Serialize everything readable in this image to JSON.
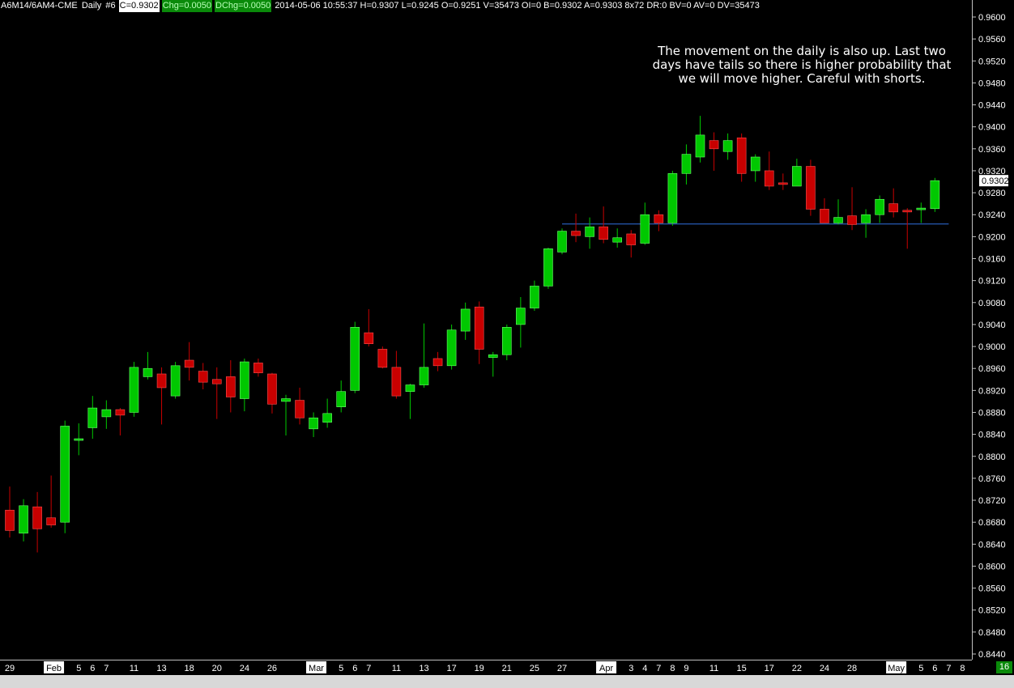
{
  "header": {
    "symbol": "A6M14/6AM4-CME",
    "interval": "Daily",
    "number": "#6",
    "close": "C=0.9302",
    "chg": "Chg=0.0050",
    "dchg": "DChg=0.0050",
    "details": "2014-05-06 10:55:37 H=0.9307 L=0.9245 O=0.9251 V=35473 OI=0 B=0.9302 A=0.9303 8x72 DR:0 BV=0 AV=0 DV=35473"
  },
  "annotation": "The movement on the daily is also up. Last two days have tails so there is higher probability that we will move higher. Careful with shorts.",
  "scroll_badge": "16",
  "colors": {
    "up": "#00c800",
    "down": "#c80000",
    "wick_up": "#00c800",
    "wick_down": "#c80000",
    "support": "#3070e0",
    "axis": "#c0c0c0"
  },
  "chart_data": {
    "type": "candlestick",
    "ylim": [
      0.8424,
      0.9624
    ],
    "y_ticks": [
      "0.9600",
      "0.9560",
      "0.9520",
      "0.9480",
      "0.9440",
      "0.9400",
      "0.9360",
      "0.9320",
      "0.9280",
      "0.9240",
      "0.9200",
      "0.9160",
      "0.9120",
      "0.9080",
      "0.9040",
      "0.9000",
      "0.8960",
      "0.8920",
      "0.8880",
      "0.8840",
      "0.8800",
      "0.8760",
      "0.8720",
      "0.8680",
      "0.8640",
      "0.8600",
      "0.8560",
      "0.8520",
      "0.8480",
      "0.8440"
    ],
    "last_price_label": "0.9302",
    "x_labels": [
      {
        "label": "29",
        "i": 0
      },
      {
        "label": "Feb",
        "i": 3.2,
        "boxed": true
      },
      {
        "label": "5",
        "i": 5
      },
      {
        "label": "6",
        "i": 6
      },
      {
        "label": "7",
        "i": 7
      },
      {
        "label": "11",
        "i": 9
      },
      {
        "label": "13",
        "i": 11
      },
      {
        "label": "18",
        "i": 13
      },
      {
        "label": "20",
        "i": 15
      },
      {
        "label": "24",
        "i": 17
      },
      {
        "label": "26",
        "i": 19
      },
      {
        "label": "Mar",
        "i": 22.2,
        "boxed": true
      },
      {
        "label": "5",
        "i": 24
      },
      {
        "label": "6",
        "i": 25
      },
      {
        "label": "7",
        "i": 26
      },
      {
        "label": "11",
        "i": 28
      },
      {
        "label": "13",
        "i": 30
      },
      {
        "label": "17",
        "i": 32
      },
      {
        "label": "19",
        "i": 34
      },
      {
        "label": "21",
        "i": 36
      },
      {
        "label": "25",
        "i": 38
      },
      {
        "label": "27",
        "i": 40
      },
      {
        "label": "Apr",
        "i": 43.2,
        "boxed": true
      },
      {
        "label": "3",
        "i": 45
      },
      {
        "label": "4",
        "i": 46
      },
      {
        "label": "7",
        "i": 47
      },
      {
        "label": "8",
        "i": 48
      },
      {
        "label": "9",
        "i": 49
      },
      {
        "label": "11",
        "i": 51
      },
      {
        "label": "15",
        "i": 53
      },
      {
        "label": "17",
        "i": 55
      },
      {
        "label": "22",
        "i": 57
      },
      {
        "label": "24",
        "i": 59
      },
      {
        "label": "28",
        "i": 61
      },
      {
        "label": "May",
        "i": 64.2,
        "boxed": true
      },
      {
        "label": "5",
        "i": 66
      },
      {
        "label": "6",
        "i": 67
      },
      {
        "label": "7",
        "i": 68
      },
      {
        "label": "8",
        "i": 69
      }
    ],
    "support_line": {
      "price": 0.9223,
      "from_i": 40,
      "to_i": 68
    },
    "candles": [
      {
        "o": 0.8702,
        "h": 0.8745,
        "l": 0.8652,
        "c": 0.8665
      },
      {
        "o": 0.866,
        "h": 0.8722,
        "l": 0.8645,
        "c": 0.871
      },
      {
        "o": 0.8708,
        "h": 0.8735,
        "l": 0.8625,
        "c": 0.8668
      },
      {
        "o": 0.8688,
        "h": 0.8765,
        "l": 0.867,
        "c": 0.8675
      },
      {
        "o": 0.868,
        "h": 0.8865,
        "l": 0.866,
        "c": 0.8855
      },
      {
        "o": 0.8832,
        "h": 0.886,
        "l": 0.8802,
        "c": 0.8832
      },
      {
        "o": 0.8852,
        "h": 0.891,
        "l": 0.8832,
        "c": 0.8888
      },
      {
        "o": 0.8872,
        "h": 0.8902,
        "l": 0.885,
        "c": 0.8885
      },
      {
        "o": 0.8885,
        "h": 0.8888,
        "l": 0.8838,
        "c": 0.8875
      },
      {
        "o": 0.888,
        "h": 0.8972,
        "l": 0.8872,
        "c": 0.8962
      },
      {
        "o": 0.8945,
        "h": 0.899,
        "l": 0.894,
        "c": 0.896
      },
      {
        "o": 0.895,
        "h": 0.8962,
        "l": 0.8858,
        "c": 0.8925
      },
      {
        "o": 0.891,
        "h": 0.8972,
        "l": 0.8905,
        "c": 0.8965
      },
      {
        "o": 0.8975,
        "h": 0.9008,
        "l": 0.8938,
        "c": 0.8962
      },
      {
        "o": 0.8955,
        "h": 0.897,
        "l": 0.8922,
        "c": 0.8935
      },
      {
        "o": 0.894,
        "h": 0.8962,
        "l": 0.8868,
        "c": 0.8932
      },
      {
        "o": 0.8945,
        "h": 0.8975,
        "l": 0.888,
        "c": 0.8908
      },
      {
        "o": 0.8905,
        "h": 0.8978,
        "l": 0.8882,
        "c": 0.8972
      },
      {
        "o": 0.897,
        "h": 0.8978,
        "l": 0.8945,
        "c": 0.8952
      },
      {
        "o": 0.895,
        "h": 0.8952,
        "l": 0.8878,
        "c": 0.8895
      },
      {
        "o": 0.89,
        "h": 0.8912,
        "l": 0.8838,
        "c": 0.8905
      },
      {
        "o": 0.8902,
        "h": 0.8925,
        "l": 0.8858,
        "c": 0.887
      },
      {
        "o": 0.885,
        "h": 0.888,
        "l": 0.8835,
        "c": 0.887
      },
      {
        "o": 0.8862,
        "h": 0.8905,
        "l": 0.8852,
        "c": 0.8878
      },
      {
        "o": 0.889,
        "h": 0.8938,
        "l": 0.888,
        "c": 0.8918
      },
      {
        "o": 0.892,
        "h": 0.9045,
        "l": 0.8915,
        "c": 0.9035
      },
      {
        "o": 0.9025,
        "h": 0.9068,
        "l": 0.9,
        "c": 0.9005
      },
      {
        "o": 0.8995,
        "h": 0.9,
        "l": 0.896,
        "c": 0.8962
      },
      {
        "o": 0.8962,
        "h": 0.8992,
        "l": 0.8905,
        "c": 0.891
      },
      {
        "o": 0.8918,
        "h": 0.8932,
        "l": 0.8868,
        "c": 0.893
      },
      {
        "o": 0.893,
        "h": 0.9042,
        "l": 0.8925,
        "c": 0.8962
      },
      {
        "o": 0.8978,
        "h": 0.899,
        "l": 0.8955,
        "c": 0.8965
      },
      {
        "o": 0.8965,
        "h": 0.904,
        "l": 0.8958,
        "c": 0.903
      },
      {
        "o": 0.9028,
        "h": 0.908,
        "l": 0.9012,
        "c": 0.9068
      },
      {
        "o": 0.9072,
        "h": 0.9082,
        "l": 0.8968,
        "c": 0.8995
      },
      {
        "o": 0.898,
        "h": 0.899,
        "l": 0.8945,
        "c": 0.8985
      },
      {
        "o": 0.8985,
        "h": 0.904,
        "l": 0.8975,
        "c": 0.9035
      },
      {
        "o": 0.904,
        "h": 0.909,
        "l": 0.8998,
        "c": 0.907
      },
      {
        "o": 0.907,
        "h": 0.912,
        "l": 0.9065,
        "c": 0.911
      },
      {
        "o": 0.911,
        "h": 0.918,
        "l": 0.9105,
        "c": 0.9178
      },
      {
        "o": 0.9172,
        "h": 0.9215,
        "l": 0.9168,
        "c": 0.921
      },
      {
        "o": 0.921,
        "h": 0.9242,
        "l": 0.919,
        "c": 0.9202
      },
      {
        "o": 0.92,
        "h": 0.9235,
        "l": 0.9178,
        "c": 0.9218
      },
      {
        "o": 0.9218,
        "h": 0.9255,
        "l": 0.9188,
        "c": 0.9195
      },
      {
        "o": 0.919,
        "h": 0.9215,
        "l": 0.918,
        "c": 0.9198
      },
      {
        "o": 0.9205,
        "h": 0.9212,
        "l": 0.9162,
        "c": 0.9185
      },
      {
        "o": 0.9188,
        "h": 0.9262,
        "l": 0.9185,
        "c": 0.924
      },
      {
        "o": 0.924,
        "h": 0.9248,
        "l": 0.921,
        "c": 0.9225
      },
      {
        "o": 0.9225,
        "h": 0.932,
        "l": 0.922,
        "c": 0.9315
      },
      {
        "o": 0.9315,
        "h": 0.9368,
        "l": 0.9295,
        "c": 0.935
      },
      {
        "o": 0.9345,
        "h": 0.942,
        "l": 0.9335,
        "c": 0.9385
      },
      {
        "o": 0.9375,
        "h": 0.939,
        "l": 0.932,
        "c": 0.936
      },
      {
        "o": 0.9355,
        "h": 0.9388,
        "l": 0.934,
        "c": 0.9375
      },
      {
        "o": 0.938,
        "h": 0.9388,
        "l": 0.93,
        "c": 0.9315
      },
      {
        "o": 0.932,
        "h": 0.935,
        "l": 0.93,
        "c": 0.9345
      },
      {
        "o": 0.932,
        "h": 0.9355,
        "l": 0.9285,
        "c": 0.9292
      },
      {
        "o": 0.9298,
        "h": 0.9315,
        "l": 0.9285,
        "c": 0.9296
      },
      {
        "o": 0.9292,
        "h": 0.9342,
        "l": 0.9292,
        "c": 0.9328
      },
      {
        "o": 0.9328,
        "h": 0.934,
        "l": 0.9238,
        "c": 0.925
      },
      {
        "o": 0.925,
        "h": 0.927,
        "l": 0.9225,
        "c": 0.9225
      },
      {
        "o": 0.9225,
        "h": 0.9268,
        "l": 0.9222,
        "c": 0.9235
      },
      {
        "o": 0.9238,
        "h": 0.929,
        "l": 0.9212,
        "c": 0.9222
      },
      {
        "o": 0.9225,
        "h": 0.925,
        "l": 0.9198,
        "c": 0.924
      },
      {
        "o": 0.924,
        "h": 0.9275,
        "l": 0.9225,
        "c": 0.9268
      },
      {
        "o": 0.926,
        "h": 0.9288,
        "l": 0.9235,
        "c": 0.9245
      },
      {
        "o": 0.9248,
        "h": 0.9252,
        "l": 0.9178,
        "c": 0.9245
      },
      {
        "o": 0.925,
        "h": 0.9262,
        "l": 0.9225,
        "c": 0.9252
      },
      {
        "o": 0.9251,
        "h": 0.9307,
        "l": 0.9245,
        "c": 0.9302
      }
    ]
  }
}
